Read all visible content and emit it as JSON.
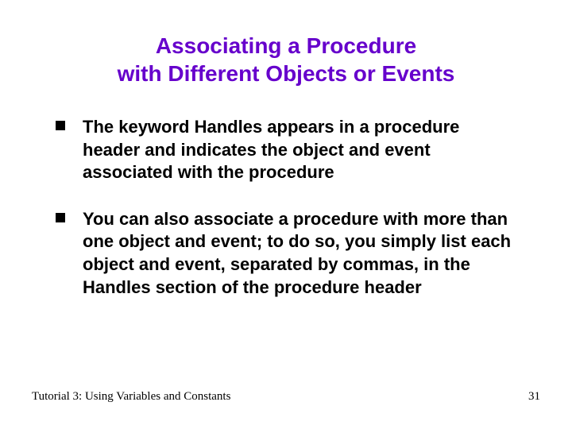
{
  "title_line1": "Associating a Procedure",
  "title_line2": "with Different Objects or Events",
  "bullets": [
    "The keyword Handles appears in a procedure header and indicates the object and event associated with the procedure",
    "You can also associate a procedure with more than one object and event; to do so, you simply list each object and event, separated by commas, in the Handles section of the procedure header"
  ],
  "footer_left": "Tutorial 3: Using Variables and Constants",
  "footer_right": "31"
}
